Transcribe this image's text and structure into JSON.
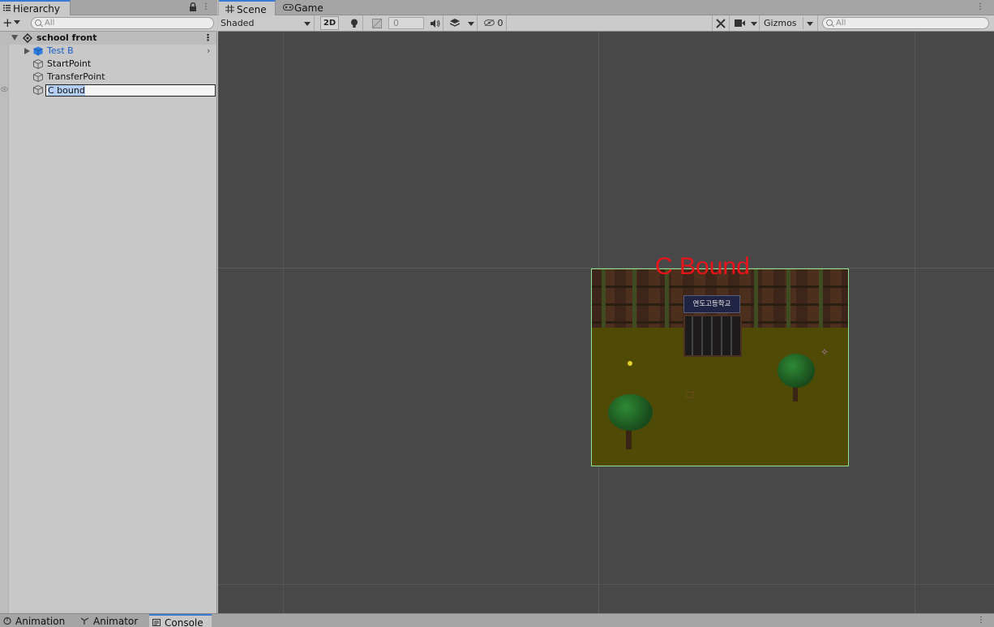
{
  "hierarchy": {
    "tab_label": "Hierarchy",
    "search_placeholder": "All",
    "scene": {
      "name": "school front"
    },
    "items": [
      {
        "label": "Test B",
        "color": "#1a5fc4",
        "has_children": true
      },
      {
        "label": "StartPoint"
      },
      {
        "label": "TransferPoint"
      },
      {
        "label": "C bound",
        "editing": true
      }
    ]
  },
  "scene_view": {
    "tabs": [
      {
        "label": "Scene",
        "active": true,
        "icon": "grid-icon"
      },
      {
        "label": "Game",
        "active": false,
        "icon": "gamepad-icon"
      }
    ],
    "toolbar": {
      "shading_mode": "Shaded",
      "mode_2d": "2D",
      "field_value": "0",
      "hidden_count": "0",
      "gizmos_label": "Gizmos",
      "search_placeholder": "All"
    },
    "overlay": {
      "bound_label": "C Bound",
      "bound_label_color": "#e8141a",
      "bound_box_color": "#8fe38a",
      "school_sign": "연도고등학교"
    }
  },
  "bottom_tabs": [
    {
      "label": "Animation",
      "icon": "animation-icon"
    },
    {
      "label": "Animator",
      "icon": "animator-icon"
    },
    {
      "label": "Console",
      "icon": "console-icon",
      "active": true
    }
  ]
}
